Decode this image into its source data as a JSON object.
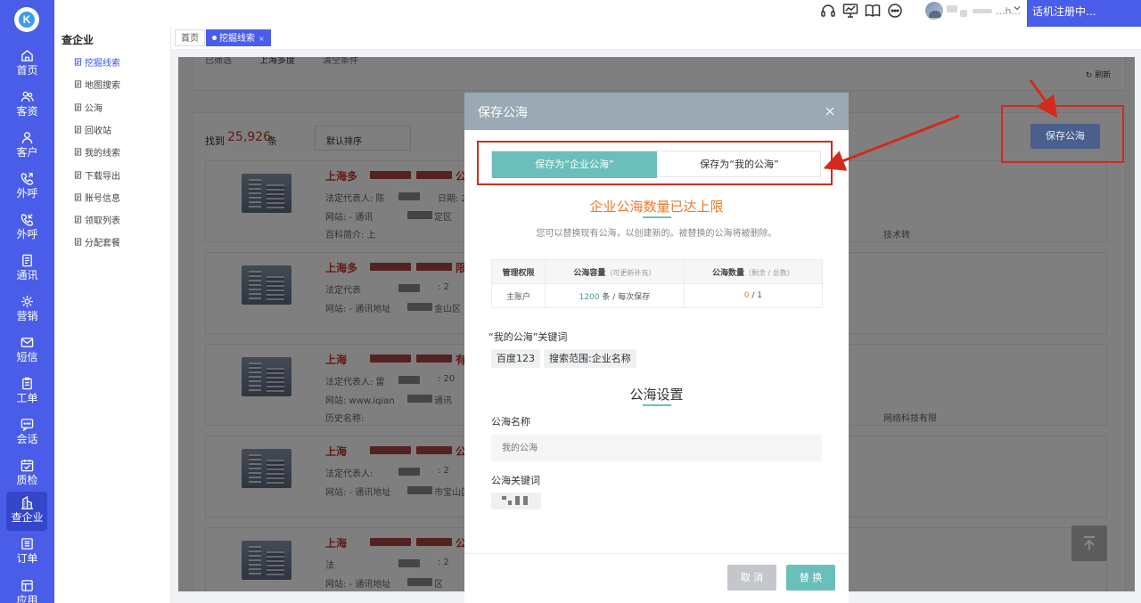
{
  "nav": {
    "items": [
      {
        "label": "首页",
        "icon": "home-icon"
      },
      {
        "label": "客资",
        "icon": "users-icon"
      },
      {
        "label": "客户",
        "icon": "customer-icon"
      },
      {
        "label": "外呼",
        "icon": "phone-out-icon"
      },
      {
        "label": "外呼",
        "icon": "phone-out-icon"
      },
      {
        "label": "通讯",
        "icon": "contacts-icon"
      },
      {
        "label": "营销",
        "icon": "marketing-icon"
      },
      {
        "label": "短信",
        "icon": "sms-icon"
      },
      {
        "label": "工单",
        "icon": "clipboard-icon"
      },
      {
        "label": "会话",
        "icon": "chat-icon"
      },
      {
        "label": "质检",
        "icon": "quality-icon"
      },
      {
        "label": "查企业",
        "icon": "building-icon",
        "active": true
      },
      {
        "label": "订单",
        "icon": "order-icon"
      },
      {
        "label": "应用",
        "icon": "apps-icon"
      }
    ]
  },
  "topbar": {
    "username": "...h...",
    "status": "话机注册中..."
  },
  "subnav": {
    "title": "查企业",
    "items": [
      "挖掘线索",
      "地图搜索",
      "公海",
      "回收站",
      "我的线索",
      "下载导出",
      "账号信息",
      "领取列表",
      "分配套餐"
    ]
  },
  "tabs": {
    "home": "首页",
    "active": "挖掘线索",
    "close": "×"
  },
  "background": {
    "filter_label": "已筛选",
    "filter_value": "上海多度",
    "clear_filter": "清空条件",
    "refresh": "刷新",
    "found_prefix": "找到",
    "found_count": "25,926",
    "found_suffix": "条",
    "sort_label": "默认排序",
    "save_button": "保存公海",
    "companies": [
      {
        "name": "上海多",
        "suffix": "公司",
        "l1": "法定代表人: 陈",
        "l1b": "日期: 2",
        "l2": "网站: -    通讯",
        "l2b": "定区",
        "l3": "百科简介: 上",
        "l3b": "技术转"
      },
      {
        "name": "上海多",
        "suffix": "限公",
        "l1": "法定代表",
        "l1b": ": 2",
        "l2": "网站: -    通讯地址",
        "l2b": "金山区",
        "l3": "",
        "l3b": ""
      },
      {
        "name": "上海",
        "suffix": "有限",
        "l1": "法定代表人: 雷",
        "l1b": ": 20",
        "l2": "网站: www.iqian",
        "l2b": "通讯",
        "l3": "历史名称:",
        "l3b": "网络科技有限"
      },
      {
        "name": "上海",
        "suffix": "公司",
        "l1": "法定代表人: ",
        "l1b": ": 2",
        "l2": "网站: -    通讯地址",
        "l2b": "市宝山区",
        "l3": "",
        "l3b": ""
      },
      {
        "name": "上海",
        "suffix": "公司",
        "l1": "法",
        "l1b": ": 2",
        "l2": "网站: -    通讯地址",
        "l2b": "区",
        "l3": "",
        "l3b": ""
      }
    ]
  },
  "modal": {
    "title": "保存公海",
    "close": "×",
    "tab_enterprise": "保存为“企业公海”",
    "tab_mine": "保存为“我的公海”",
    "limit_title": "企业公海数量已达上限",
    "limit_desc": "您可以替换现有公海，以创建新的。被替换的公海将被删除。",
    "table": {
      "h1": "管理权限",
      "h2": "公海容量",
      "h2_sub": "（可更新补充）",
      "h3": "公海数量",
      "h3_sub": "（剩余 / 总数）",
      "role": "主账户",
      "capacity_num": "1200",
      "capacity_rest": " 条 / 每次保存",
      "count_num": "0",
      "count_rest": " / 1"
    },
    "keywords_title": "“我的公海”关键词",
    "keywords": [
      "百度123",
      "搜索范围:企业名称"
    ],
    "settings_title": "公海设置",
    "name_label": "公海名称",
    "name_placeholder": "我的公海",
    "kw_label": "公海关键词",
    "cancel": "取 消",
    "replace": "替 换"
  },
  "colors": {
    "nav_bg": "#4a5de8",
    "accent_teal": "#6bbfba",
    "warning_orange": "#e87a2a",
    "annotation_red": "#d32a1e"
  }
}
